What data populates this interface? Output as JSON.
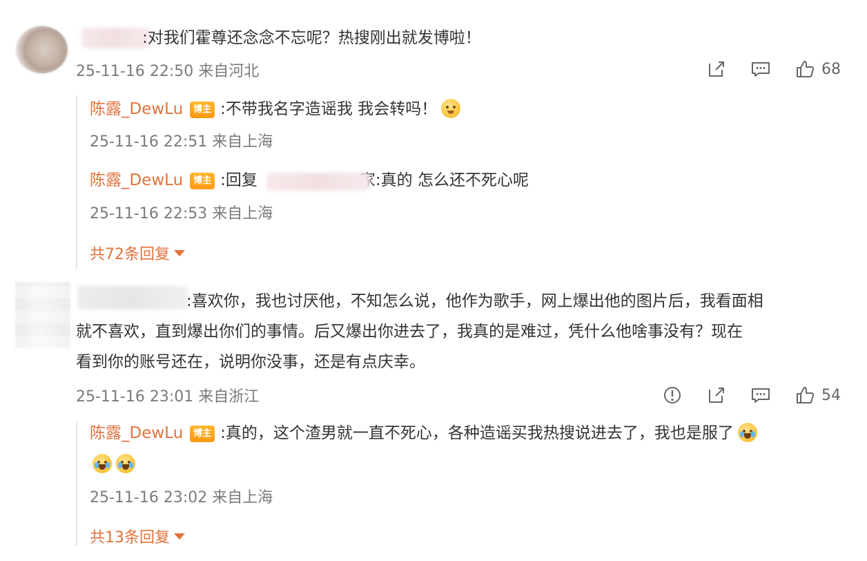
{
  "comments": [
    {
      "text_suffix": ":对我们霍尊还念念不忘呢？热搜刚出就发博啦！",
      "meta": "25-11-16 22:50 来自河北",
      "like_count": "68",
      "replies": [
        {
          "author": "陈露_DewLu",
          "badge": "博主",
          "text": ":不带我名字造谣我 我会转吗！",
          "meta": "25-11-16 22:51 来自上海"
        },
        {
          "author": "陈露_DewLu",
          "badge": "博主",
          "text_prefix": ":回复",
          "text_suffix": "家:真的 怎么还不死心呢",
          "meta": "25-11-16 22:53 来自上海"
        }
      ],
      "more_replies": "共72条回复"
    },
    {
      "text_suffix": ":喜欢你，我也讨厌他，不知怎么说，他作为歌手，网上爆出他的图片后，我看面相",
      "text_line2": "就不喜欢，直到爆出你们的事情。后又爆出你进去了，我真的是难过，凭什么他啥事没有？现在",
      "text_line3": "看到你的账号还在，说明你没事，还是有点庆幸。",
      "meta": "25-11-16 23:01 来自浙江",
      "like_count": "54",
      "replies": [
        {
          "author": "陈露_DewLu",
          "badge": "博主",
          "text": ":真的，这个渣男就一直不死心，各种造谣买我热搜说进去了，我也是服了",
          "meta": "25-11-16 23:02 来自上海"
        }
      ],
      "more_replies": "共13条回复"
    }
  ],
  "icons": [
    "share-icon",
    "comment-icon",
    "like-icon",
    "report-icon",
    "emoji-smirk",
    "emoji-cry"
  ],
  "colors": {
    "name": "#e2723c",
    "badge": "#ff9a12",
    "meta": "#7a7a7a"
  }
}
